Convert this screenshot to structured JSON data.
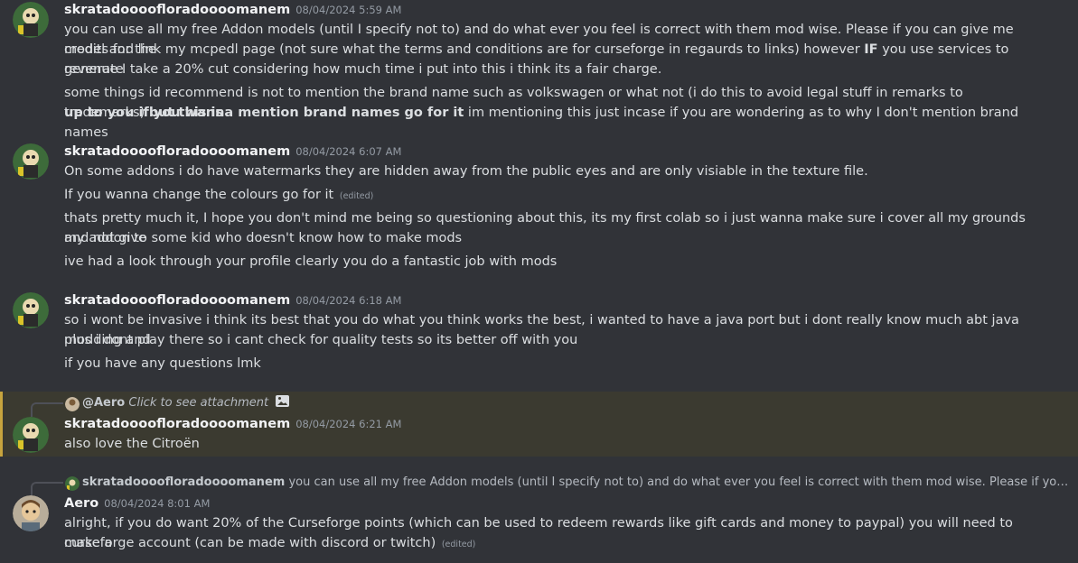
{
  "messages": [
    {
      "username": "skratadoooofloradoooomanem",
      "timestamp": "08/04/2024 5:59 AM",
      "lines": [
        "you can use all my free Addon models (until I specify not to) and do what ever you feel is correct with them mod wise. Please if you can give me credits for the",
        "model and link my mcpedl page (not sure what the terms and conditions are for curseforge in regaurds to links) however ",
        "IF",
        " you use services to generate",
        "revenue I take a 20% cut considering how much time i put into this i think its a fair charge.",
        "some things id recommend is not to mention the brand name such as volkswagen or what not (i do this to avoid legal stuff in remarks to trademarks) ",
        "but this is",
        "up to you if you wanna mention brand names go for it",
        " im mentioning this just incase if you are wondering as to why I don't mention brand names"
      ]
    },
    {
      "username": "skratadoooofloradoooomanem",
      "timestamp": "08/04/2024 6:07 AM",
      "lines": [
        "On some addons i do have watermarks they are hidden away from the public eyes and are only visiable in the texture file.",
        "If you wanna change the colours go for it",
        "(edited)",
        "thats pretty much it, I hope you don't mind me being so questioning about this, its my first colab so i just wanna make sure i cover all my grounds and not give",
        "my addon to some kid who doesn't know how to make mods",
        "ive had a look through your profile clearly you do a fantastic job with mods"
      ]
    },
    {
      "username": "skratadoooofloradoooomanem",
      "timestamp": "08/04/2024 6:18 AM",
      "lines": [
        "so i wont be invasive i think its best that you do what you think works the best, i wanted to have a java port but i dont really know much abt java modding and",
        "plus i dont play there so i cant check for quality tests so its better off with you",
        "if you have any questions lmk"
      ]
    },
    {
      "reply_name": "@Aero",
      "reply_text": "Click to see attachment",
      "reply_icon": "image-icon",
      "username": "skratadoooofloradoooomanem",
      "timestamp": "08/04/2024 6:21 AM",
      "lines": [
        "also love the Citroën"
      ]
    },
    {
      "reply_name": "skratadoooofloradoooomanem",
      "reply_text": "you can use all my free Addon models (until I specify not to) and do what ever you feel is correct with them mod wise. Please if you can give me cr...",
      "username": "Aero",
      "timestamp": "08/04/2024 8:01 AM",
      "lines": [
        "alright, if you do want 20% of the Curseforge points (which can be used to redeem rewards like gift cards and money to paypal) you will need to make a",
        "curseforge account (can be made with discord or twitch)",
        "(edited)"
      ]
    }
  ],
  "colors": {
    "background": "#313338",
    "highlight": "#3b3a30",
    "highlight_bar": "#c7a43e",
    "username": "#f2f3f5",
    "timestamp": "#949ba4",
    "text": "#dbdee1"
  }
}
